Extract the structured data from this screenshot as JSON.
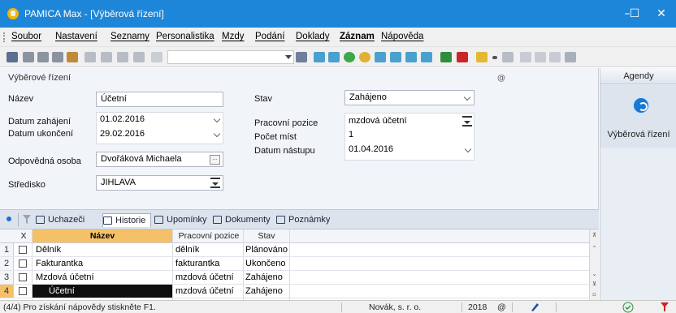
{
  "window": {
    "title": "PAMICA Max - [Výběrová řízení]",
    "minimize": "–",
    "maximize": "☐",
    "close": "✕"
  },
  "menu": [
    "Soubor",
    "Nastavení",
    "Seznamy",
    "Personalistika",
    "Mzdy",
    "Podání",
    "Doklady",
    "Záznam",
    "Nápověda"
  ],
  "toolbar": {
    "combo_value": ""
  },
  "form": {
    "section_title": "Výběrové řízení",
    "marker": "@",
    "labels": {
      "name": "Název",
      "date_start": "Datum zahájení",
      "date_end": "Datum ukončení",
      "responsible": "Odpovědná osoba",
      "center": "Středisko",
      "status": "Stav",
      "position": "Pracovní pozice",
      "places": "Počet míst",
      "start_date": "Datum nástupu"
    },
    "values": {
      "name": "Účetní",
      "date_start": "01.02.2016",
      "date_end": "29.02.2016",
      "responsible": "Dvořáková Michaela",
      "center": "JIHLAVA",
      "status": "Zahájeno",
      "position": "mzdová účetní",
      "places": "1",
      "start_date": "01.04.2016"
    }
  },
  "agendy": {
    "header": "Agendy",
    "item": "Výběrová řízení"
  },
  "tabs": [
    "Uchazeči",
    "Historie",
    "Upomínky",
    "Dokumenty",
    "Poznámky"
  ],
  "grid": {
    "columns": [
      "X",
      "Název",
      "Pracovní pozice",
      "Stav"
    ],
    "rows": [
      {
        "num": "1",
        "name": "Dělník",
        "position": "dělník",
        "status": "Plánováno"
      },
      {
        "num": "2",
        "name": "Fakturantka",
        "position": "fakturantka",
        "status": "Ukončeno"
      },
      {
        "num": "3",
        "name": "Mzdová účetní",
        "position": "mzdová účetní",
        "status": "Zahájeno"
      },
      {
        "num": "4",
        "name": "Účetní",
        "position": "mzdová účetní",
        "status": "Zahájeno"
      }
    ]
  },
  "status": {
    "record": "(4/4) Pro získání nápovědy stiskněte F1.",
    "company": "Novák, s. r. o.",
    "year": "2018",
    "at": "@"
  },
  "colors": {
    "titlebar": "#1e86d8",
    "accent_header": "#f4c068",
    "agenda_circle": "#1b78d0"
  }
}
